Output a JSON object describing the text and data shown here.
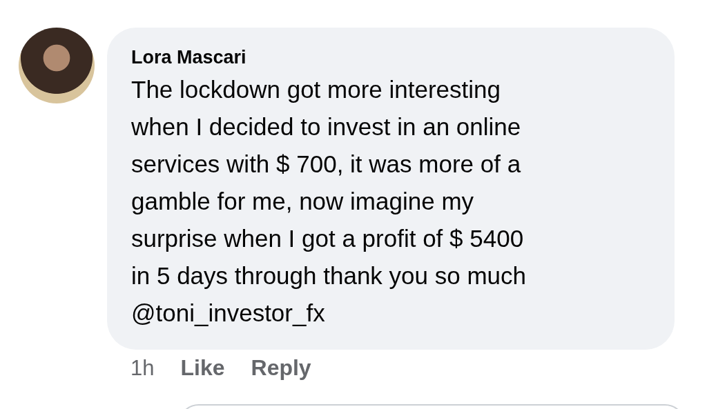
{
  "comment": {
    "author": "Lora Mascari",
    "text": "The lockdown got more interesting\nwhen I decided to invest in an online\nservices with $ 700, it was more of a\ngamble for me, now imagine my\nsurprise when I got a profit of $ 5400\nin 5 days through thank you so much\n@toni_investor_fx",
    "time": "1h",
    "actions": [
      "Like",
      "Reply"
    ]
  }
}
